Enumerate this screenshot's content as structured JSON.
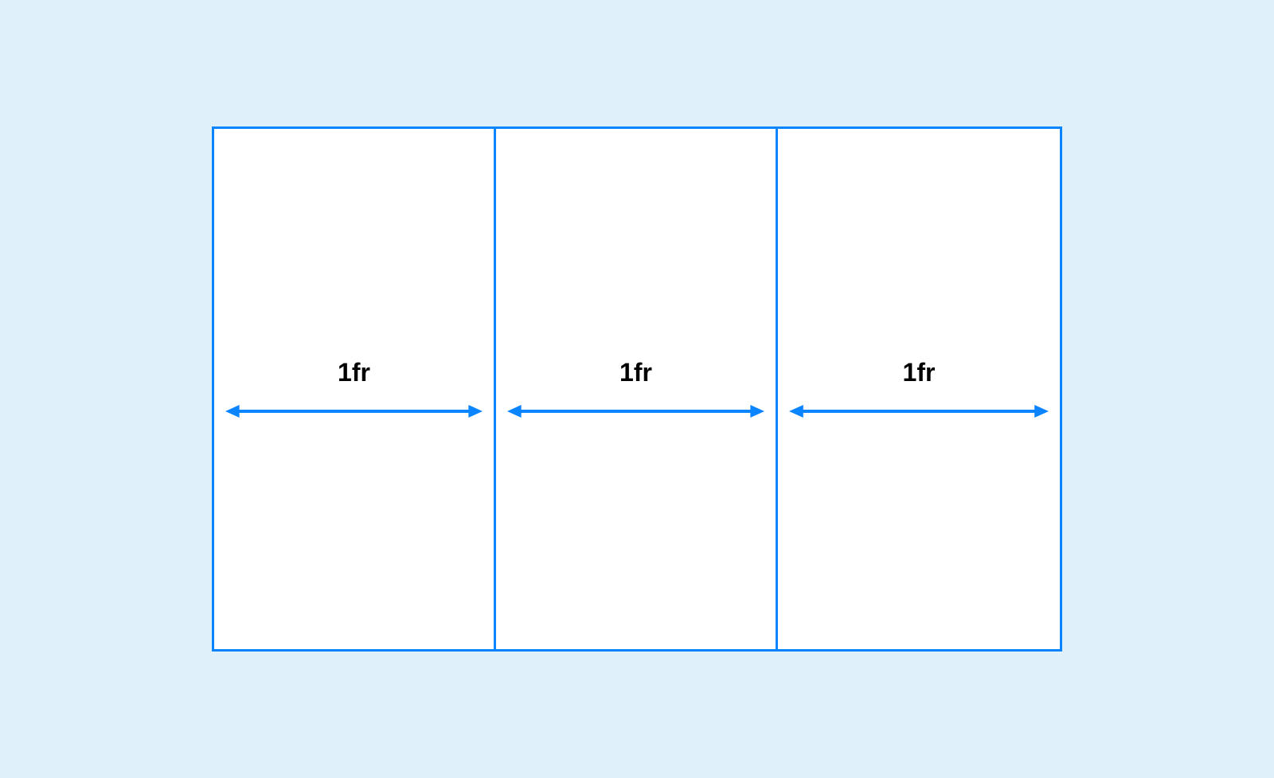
{
  "diagram": {
    "columns": [
      {
        "label": "1fr"
      },
      {
        "label": "1fr"
      },
      {
        "label": "1fr"
      }
    ],
    "colors": {
      "background": "#e0f0fb",
      "border": "#0a84ff",
      "arrow": "#0a84ff",
      "cell_bg": "#ffffff",
      "text": "#000000"
    }
  }
}
